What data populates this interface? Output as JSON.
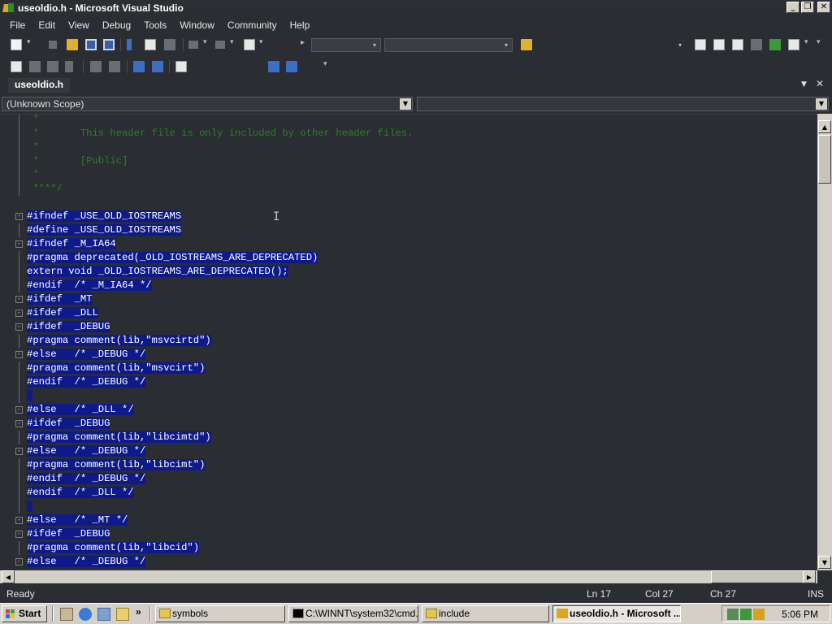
{
  "window": {
    "title": "useoldio.h - Microsoft Visual Studio",
    "minimize_glyph": "_",
    "restore_glyph": "❐",
    "close_glyph": "✕"
  },
  "menu": [
    "File",
    "Edit",
    "View",
    "Debug",
    "Tools",
    "Window",
    "Community",
    "Help"
  ],
  "document_tab": {
    "label": "useoldio.h",
    "dropdown_glyph": "▼",
    "close_glyph": "✕"
  },
  "scope_bar": {
    "scope_value": "(Unknown Scope)",
    "member_value": ""
  },
  "editor": {
    "mouse_cursor_glyph": "I",
    "lines": [
      {
        "text": " *",
        "kind": "comment",
        "selected": false,
        "fold": "",
        "gutter_line": true
      },
      {
        "text": " *       This header file is only included by other header files.",
        "kind": "comment",
        "selected": false,
        "fold": "",
        "gutter_line": true
      },
      {
        "text": " *",
        "kind": "comment",
        "selected": false,
        "fold": "",
        "gutter_line": true
      },
      {
        "text": " *       [Public]",
        "kind": "comment",
        "selected": false,
        "fold": "",
        "gutter_line": true
      },
      {
        "text": " *",
        "kind": "comment",
        "selected": false,
        "fold": "",
        "gutter_line": true
      },
      {
        "text": " ****/",
        "kind": "comment",
        "selected": false,
        "fold": "",
        "gutter_line": true
      },
      {
        "text": "",
        "kind": "blank",
        "selected": false,
        "fold": "",
        "gutter_line": false
      },
      {
        "text": "#ifndef _USE_OLD_IOSTREAMS",
        "kind": "code",
        "selected": true,
        "fold": "⊟",
        "gutter_line": false,
        "keyword": "#ifndef"
      },
      {
        "text": "#define _USE_OLD_IOSTREAMS",
        "kind": "code",
        "selected": true,
        "fold": "",
        "gutter_line": true
      },
      {
        "text": "#ifndef _M_IA64",
        "kind": "code",
        "selected": true,
        "fold": "⊟",
        "gutter_line": false
      },
      {
        "text": "#pragma deprecated(_OLD_IOSTREAMS_ARE_DEPRECATED)",
        "kind": "code",
        "selected": true,
        "fold": "",
        "gutter_line": true
      },
      {
        "text": "extern void _OLD_IOSTREAMS_ARE_DEPRECATED();",
        "kind": "code",
        "selected": true,
        "fold": "",
        "gutter_line": true
      },
      {
        "text": "#endif  /* _M_IA64 */",
        "kind": "code",
        "selected": true,
        "fold": "",
        "gutter_line": true
      },
      {
        "text": "#ifdef  _MT",
        "kind": "code",
        "selected": true,
        "fold": "⊟",
        "gutter_line": false
      },
      {
        "text": "#ifdef  _DLL",
        "kind": "code",
        "selected": true,
        "fold": "⊟",
        "gutter_line": false
      },
      {
        "text": "#ifdef  _DEBUG",
        "kind": "code",
        "selected": true,
        "fold": "⊟",
        "gutter_line": false
      },
      {
        "text": "#pragma comment(lib,\"msvcirtd\")",
        "kind": "code",
        "selected": true,
        "fold": "",
        "gutter_line": true
      },
      {
        "text": "#else   /* _DEBUG */",
        "kind": "code",
        "selected": true,
        "fold": "⊟",
        "gutter_line": false
      },
      {
        "text": "#pragma comment(lib,\"msvcirt\")",
        "kind": "code",
        "selected": true,
        "fold": "",
        "gutter_line": true
      },
      {
        "text": "#endif  /* _DEBUG */",
        "kind": "code",
        "selected": true,
        "fold": "",
        "gutter_line": true
      },
      {
        "text": " ",
        "kind": "code",
        "selected": true,
        "fold": "",
        "gutter_line": true
      },
      {
        "text": "#else   /* _DLL */",
        "kind": "code",
        "selected": true,
        "fold": "⊟",
        "gutter_line": false
      },
      {
        "text": "#ifdef  _DEBUG",
        "kind": "code",
        "selected": true,
        "fold": "⊟",
        "gutter_line": false
      },
      {
        "text": "#pragma comment(lib,\"libcimtd\")",
        "kind": "code",
        "selected": true,
        "fold": "",
        "gutter_line": true
      },
      {
        "text": "#else   /* _DEBUG */",
        "kind": "code",
        "selected": true,
        "fold": "⊟",
        "gutter_line": false
      },
      {
        "text": "#pragma comment(lib,\"libcimt\")",
        "kind": "code",
        "selected": true,
        "fold": "",
        "gutter_line": true
      },
      {
        "text": "#endif  /* _DEBUG */",
        "kind": "code",
        "selected": true,
        "fold": "",
        "gutter_line": true
      },
      {
        "text": "#endif  /* _DLL */",
        "kind": "code",
        "selected": true,
        "fold": "",
        "gutter_line": true
      },
      {
        "text": " ",
        "kind": "code",
        "selected": true,
        "fold": "",
        "gutter_line": true
      },
      {
        "text": "#else   /* _MT */",
        "kind": "code",
        "selected": true,
        "fold": "⊟",
        "gutter_line": false
      },
      {
        "text": "#ifdef  _DEBUG",
        "kind": "code",
        "selected": true,
        "fold": "⊟",
        "gutter_line": false
      },
      {
        "text": "#pragma comment(lib,\"libcid\")",
        "kind": "code",
        "selected": true,
        "fold": "",
        "gutter_line": true
      },
      {
        "text": "#else   /* _DEBUG */",
        "kind": "code",
        "selected": true,
        "fold": "⊟",
        "gutter_line": false
      }
    ]
  },
  "status_bar": {
    "state": "Ready",
    "line": "Ln 17",
    "column": "Col 27",
    "character": "Ch 27",
    "mode": "INS"
  },
  "taskbar": {
    "start_label": "Start",
    "quick_launch_more": "»",
    "tasks": [
      {
        "label": "symbols",
        "icon": "folder-icon",
        "active": false
      },
      {
        "label": "C:\\WINNT\\system32\\cmd...",
        "icon": "cmd-icon",
        "active": false
      },
      {
        "label": "include",
        "icon": "folder-icon",
        "active": false
      },
      {
        "label": "useoldio.h - Microsoft ...",
        "icon": "visual-studio-icon",
        "active": true
      }
    ],
    "clock": "5:06 PM"
  },
  "colors": {
    "background": "#2a2d31",
    "selection": "#0f1a8a",
    "comment": "#2f7d2f",
    "keyword": "#2a3fe0"
  }
}
